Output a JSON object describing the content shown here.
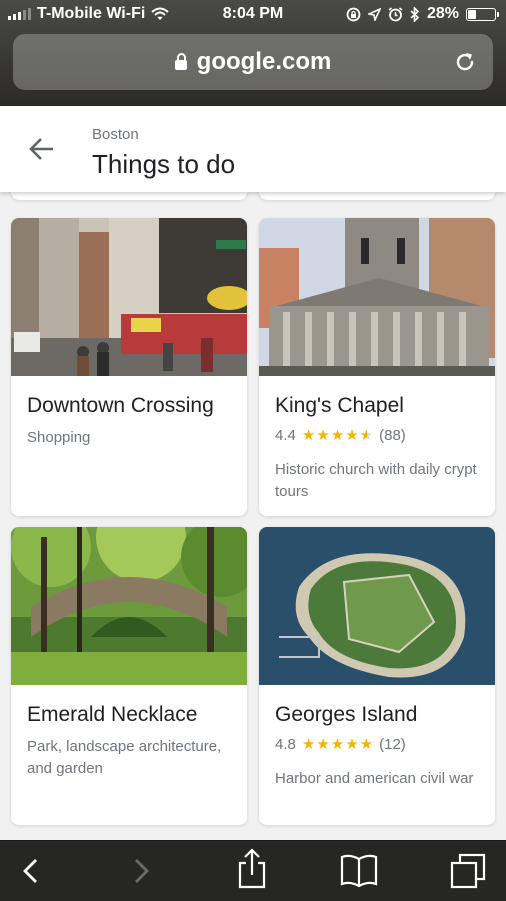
{
  "status_bar": {
    "carrier": "T-Mobile Wi-Fi",
    "time": "8:04 PM",
    "battery_percent": "28%",
    "battery_level": 0.28,
    "icons": [
      "signal-icon",
      "wifi-icon",
      "screen-lock-icon",
      "location-arrow-icon",
      "alarm-icon",
      "bluetooth-icon",
      "battery-icon"
    ]
  },
  "browser": {
    "url": "google.com",
    "icons": [
      "lock-icon",
      "reload-icon"
    ]
  },
  "header": {
    "subtitle": "Boston",
    "title": "Things to do",
    "back_icon": "arrow-left-icon"
  },
  "cards": [
    {
      "name": "Downtown Crossing",
      "category": "Shopping"
    },
    {
      "name": "King's Chapel",
      "rating": "4.4",
      "stars": 4.4,
      "reviews": "(88)",
      "description": "Historic church with daily crypt tours"
    },
    {
      "name": "Emerald Necklace",
      "category": "Park, landscape architecture, and garden"
    },
    {
      "name": "Georges Island",
      "rating": "4.8",
      "stars": 4.8,
      "reviews": "(12)",
      "description": "Harbor and american civil war"
    }
  ],
  "toolbar": {
    "icons": [
      "back-chevron-icon",
      "forward-chevron-icon",
      "share-icon",
      "bookmarks-icon",
      "tabs-icon"
    ]
  },
  "colors": {
    "star": "#f2b600",
    "title_text": "#202124",
    "secondary_text": "#70757a",
    "toolbar_bg": "#262624"
  }
}
